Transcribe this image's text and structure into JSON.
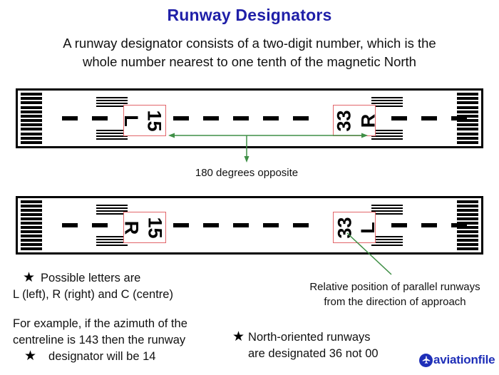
{
  "header": {
    "title": "Runway Designators",
    "subtitle_line1": "A runway designator consists of a two-digit number, which is the",
    "subtitle_line2": "whole number nearest to one tenth of the magnetic North"
  },
  "colors": {
    "title_blue": "#1f1fa8",
    "designator_border_red": "#e2666a",
    "annotation_green": "#3f8f46",
    "logo_blue": "#1f2fb8",
    "runway_black": "#000000"
  },
  "runways": [
    {
      "name": "runway-top",
      "left_designator": {
        "number": "15",
        "letter": "L"
      },
      "right_designator": {
        "number": "33",
        "letter": "R"
      },
      "threshold_bar_count": 12,
      "touchdown_line_count": 4,
      "centerline_dash_count": 11
    },
    {
      "name": "runway-bottom",
      "left_designator": {
        "number": "15",
        "letter": "R"
      },
      "right_designator": {
        "number": "33",
        "letter": "L"
      },
      "threshold_bar_count": 12,
      "touchdown_line_count": 4,
      "centerline_dash_count": 11
    }
  ],
  "annotations": {
    "opposite_caption": "180 degrees opposite",
    "parallel_caption_line1": "Relative position of parallel runways",
    "parallel_caption_line2": "from the direction of approach"
  },
  "notes": [
    {
      "id": "note-letters",
      "bullet": "★",
      "line1": "Possible letters are",
      "line2": "L (left), R (right) and C (centre)"
    },
    {
      "id": "note-example",
      "bullet": "★",
      "line1": "For example, if the azimuth of the",
      "line2": "centreline is 143 then the runway",
      "line3": "designator will be 14"
    },
    {
      "id": "note-north",
      "bullet": "★",
      "line1": "North-oriented runways",
      "line2": "are designated 36 not 00"
    }
  ],
  "logo": {
    "brand": "aviationfile",
    "icon": "airplane-icon"
  }
}
